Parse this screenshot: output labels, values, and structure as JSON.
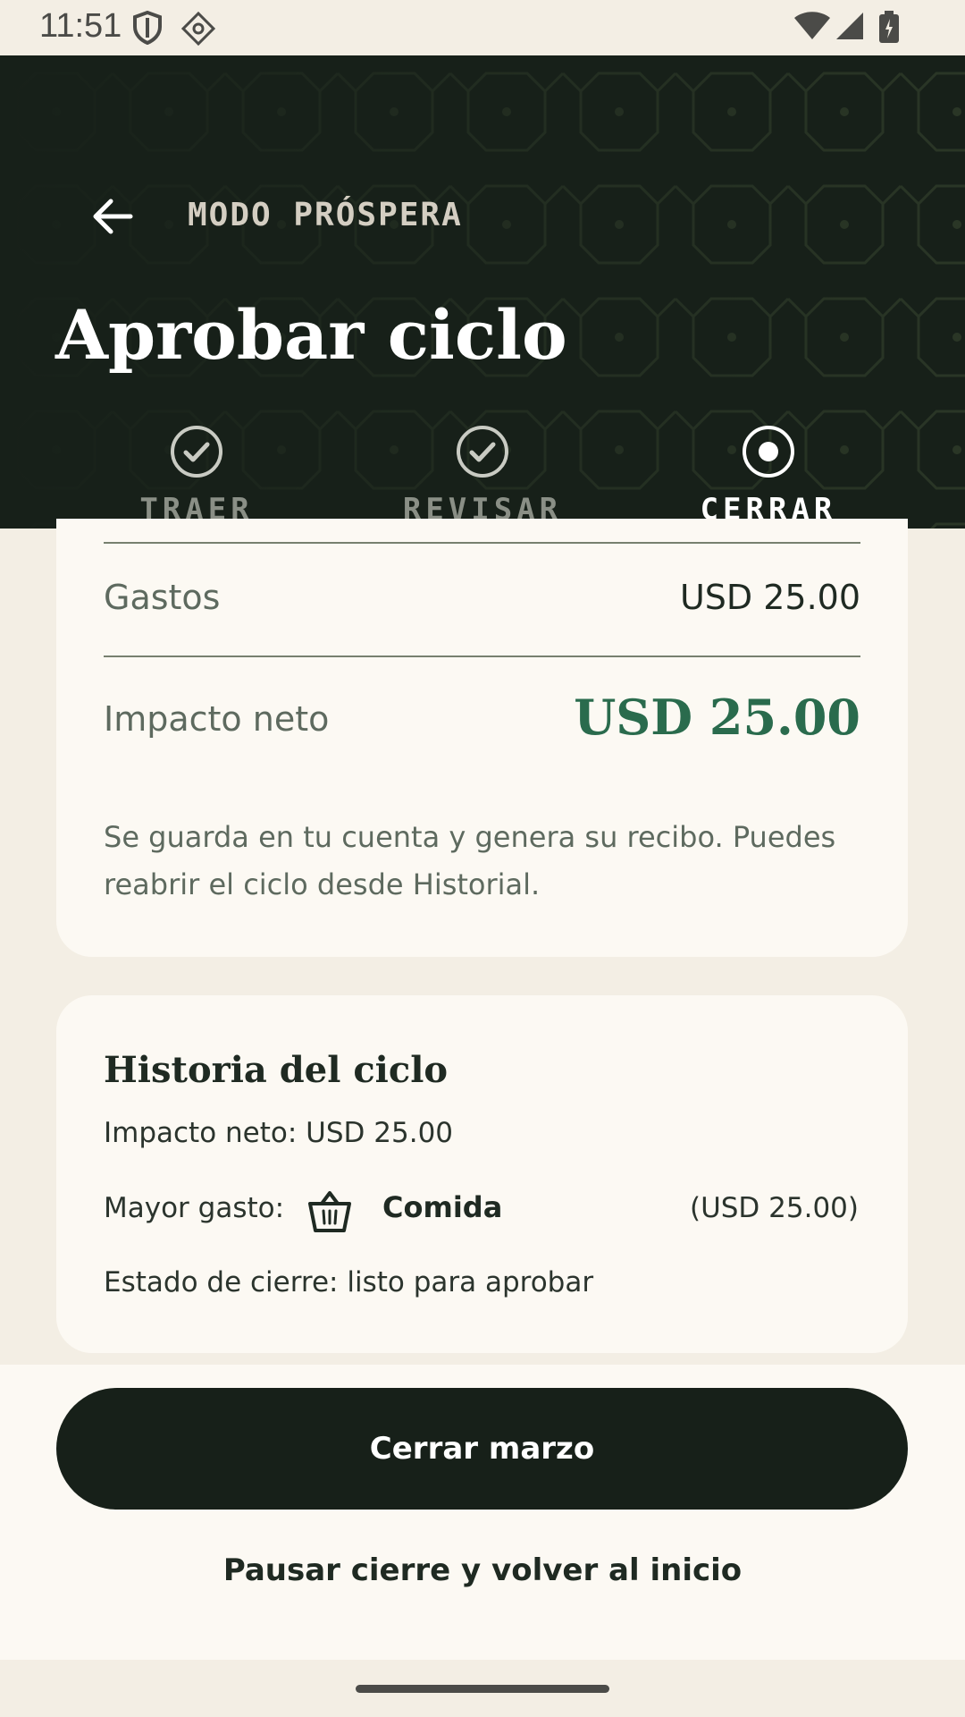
{
  "status_bar": {
    "time": "11:51",
    "icons": [
      "shield-icon",
      "vpn-icon",
      "wifi-icon",
      "signal-icon",
      "battery-icon"
    ]
  },
  "header": {
    "back_icon": "arrow-left-icon",
    "eyebrow": "MODO PRÓSPERA",
    "title": "Aprobar ciclo",
    "steps": [
      {
        "label": "TRAER",
        "state": "done"
      },
      {
        "label": "REVISAR",
        "state": "done"
      },
      {
        "label": "CERRAR",
        "state": "active"
      }
    ]
  },
  "summary": {
    "expenses_label": "Gastos",
    "expenses_value": "USD 25.00",
    "net_label": "Impacto neto",
    "net_value": "USD 25.00",
    "note": "Se guarda en tu cuenta y genera su recibo. Puedes reabrir el ciclo desde Historial."
  },
  "history": {
    "title": "Historia del ciclo",
    "net_line": "Impacto neto: USD 25.00",
    "top_expense_label": "Mayor gasto:",
    "top_expense_icon": "basket-icon",
    "top_expense_category": "Comida",
    "top_expense_amount": "(USD 25.00)",
    "status_line": "Estado de cierre: listo para aprobar"
  },
  "actions": {
    "primary": "Cerrar marzo",
    "secondary": "Pausar cierre y volver al inicio"
  },
  "colors": {
    "header_bg": "#172019",
    "accent_green": "#2a6b4d",
    "card_bg": "#fcf9f3",
    "page_bg": "#f3eee4"
  }
}
